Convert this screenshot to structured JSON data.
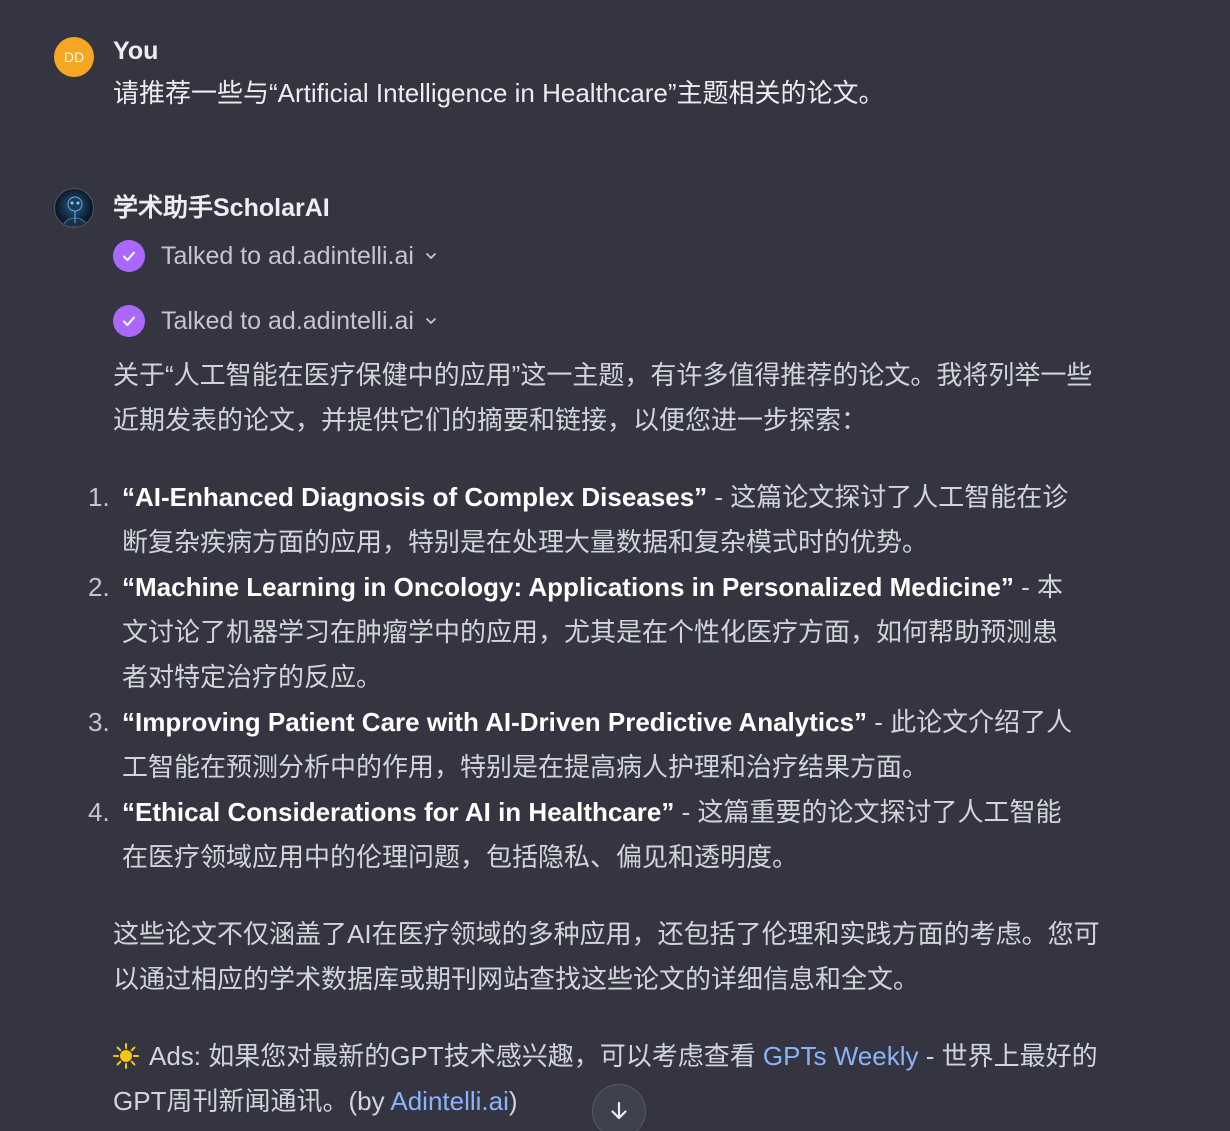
{
  "user_message": {
    "avatar_initials": "DD",
    "author": "You",
    "text": "请推荐一些与“Artificial Intelligence in Healthcare”主题相关的论文。"
  },
  "assistant_message": {
    "author": "学术助手ScholarAI",
    "tool_calls": [
      {
        "label": "Talked to ad.adintelli.ai",
        "icon": "check-circle-icon"
      },
      {
        "label": "Talked to ad.adintelli.ai",
        "icon": "check-circle-icon"
      }
    ],
    "intro_line1": "关于“人工智能在医疗保健中的应用”这一主题，有许多值得推荐的论文。我将列举一些",
    "intro_line2": "近期发表的论文，并提供它们的摘要和链接，以便您进一步探索：",
    "papers": [
      {
        "number": "1.",
        "title": "“AI-Enhanced Diagnosis of Complex Diseases”",
        "desc": " - 这篇论文探讨了人工智能在诊断复杂疾病方面的应用，特别是在处理大量数据和复杂模式时的优势。"
      },
      {
        "number": "2.",
        "title": "“Machine Learning in Oncology: Applications in Personalized Medicine”",
        "desc": " - 本文讨论了机器学习在肿瘤学中的应用，尤其是在个性化医疗方面，如何帮助预测患者对特定治疗的反应。"
      },
      {
        "number": "3.",
        "title": "“Improving Patient Care with AI-Driven Predictive Analytics”",
        "desc": " - 此论文介绍了人工智能在预测分析中的作用，特别是在提高病人护理和治疗结果方面。"
      },
      {
        "number": "4.",
        "title": "“Ethical Considerations for AI in Healthcare”",
        "desc": " - 这篇重要的论文探讨了人工智能在医疗领域应用中的伦理问题，包括隐私、偏见和透明度。"
      }
    ],
    "summary_line1": "这些论文不仅涵盖了AI在医疗领域的多种应用，还包括了伦理和实践方面的考虑。您可",
    "summary_line2": "以通过相应的学术数据库或期刊网站查找这些论文的详细信息和全文。",
    "ad": {
      "prefix": "Ads: 如果您对最新的GPT技术感兴趣，可以考虑查看 ",
      "link1": "GPTs Weekly",
      "middle": " - 世界上最好的",
      "line2_prefix": "GPT周刊新闻通讯。(by ",
      "link2": "Adintelli.ai",
      "suffix": ")"
    }
  },
  "colors": {
    "background": "#343541",
    "check_purple": "#ab68ff",
    "link_blue": "#8ab4f8",
    "user_avatar": "#f5a623"
  }
}
